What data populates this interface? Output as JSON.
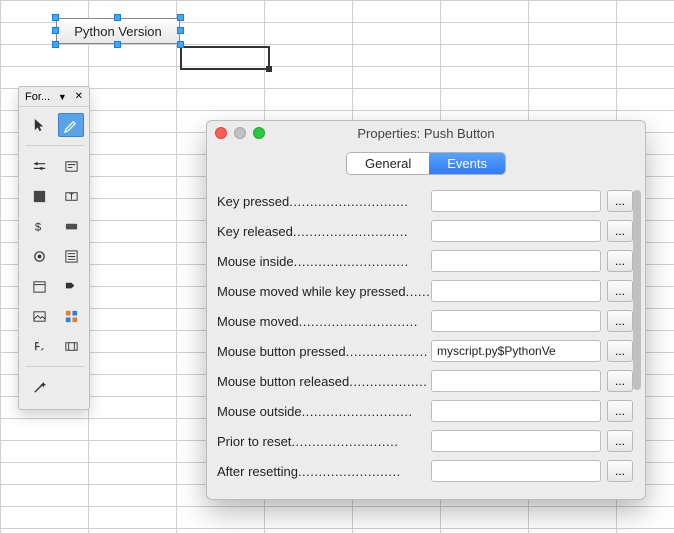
{
  "sheet": {
    "button_label": "Python Version"
  },
  "toolbox": {
    "title": "For...",
    "tools": [
      {
        "id": "pointer-icon",
        "name": "pointer"
      },
      {
        "id": "pencil-icon",
        "name": "design-mode",
        "selected": true
      },
      {
        "id": "scrollbar-icon",
        "name": "scrollbar-control"
      },
      {
        "id": "label-icon",
        "name": "label-control"
      },
      {
        "id": "groupbox-icon",
        "name": "group-box"
      },
      {
        "id": "textbox-icon",
        "name": "text-box"
      },
      {
        "id": "currency-icon",
        "name": "currency-field"
      },
      {
        "id": "button-icon",
        "name": "push-button"
      },
      {
        "id": "radio-icon",
        "name": "option-button"
      },
      {
        "id": "listbox-icon",
        "name": "list-box"
      },
      {
        "id": "date-icon",
        "name": "date-field"
      },
      {
        "id": "more-icon",
        "name": "more-controls"
      },
      {
        "id": "image-icon",
        "name": "image-control"
      },
      {
        "id": "pattern-icon",
        "name": "pattern-field"
      },
      {
        "id": "formatted-icon",
        "name": "formatted-field"
      },
      {
        "id": "nav-icon",
        "name": "navigation-bar"
      },
      {
        "id": "wizard-icon",
        "name": "form-wizard"
      }
    ]
  },
  "dialog": {
    "title": "Properties: Push Button",
    "tabs": {
      "general": "General",
      "events": "Events"
    },
    "active_tab": "events",
    "picker_label": "...",
    "events": [
      {
        "label": "Key pressed",
        "value": ""
      },
      {
        "label": "Key released",
        "value": ""
      },
      {
        "label": "Mouse inside",
        "value": ""
      },
      {
        "label": "Mouse moved while key pressed",
        "value": ""
      },
      {
        "label": "Mouse moved",
        "value": ""
      },
      {
        "label": "Mouse button pressed",
        "value": "myscript.py$PythonVe"
      },
      {
        "label": "Mouse button released",
        "value": ""
      },
      {
        "label": "Mouse outside",
        "value": ""
      },
      {
        "label": "Prior to reset",
        "value": ""
      },
      {
        "label": "After resetting",
        "value": ""
      }
    ]
  }
}
